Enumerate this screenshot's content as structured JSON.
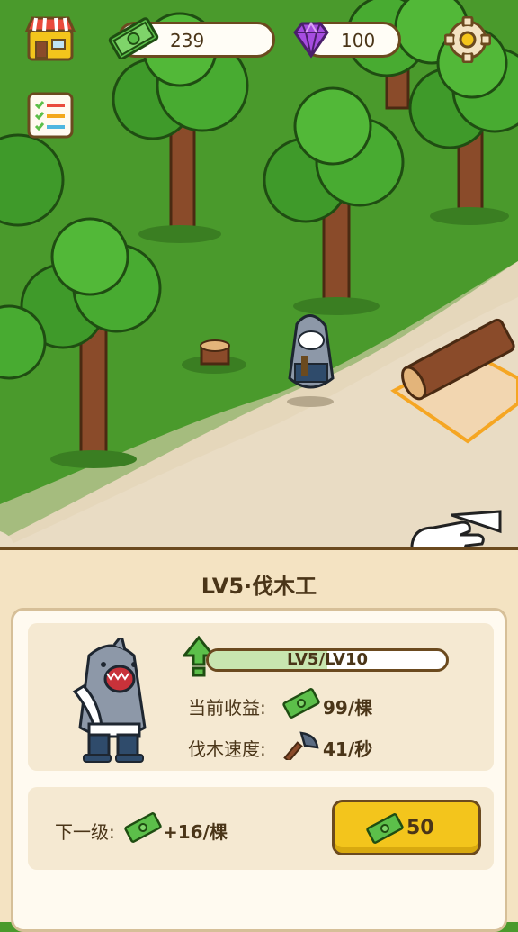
{
  "hud": {
    "cash": "239",
    "gems": "100"
  },
  "panel": {
    "title": "LV5·伐木工",
    "level_progress": "LV5/LV10",
    "level_current": 5,
    "level_max": 10,
    "income_label": "当前收益:",
    "income_value": "99/棵",
    "speed_label": "伐木速度:",
    "speed_value": "41/秒",
    "next_label": "下一级:",
    "next_value": "+16/棵",
    "upgrade_price": "50"
  },
  "colors": {
    "grass": "#4a9a2c",
    "path": "#e9dcc4",
    "panel_bg": "#f4e3c2",
    "button_yellow": "#f3c51c",
    "outline_brown": "#6b4a1f",
    "cash_green": "#5cbf4a",
    "gem_purple": "#a64de0"
  },
  "icons": [
    "shop-icon",
    "task-list-icon",
    "settings-gear-icon",
    "cash-icon",
    "gem-icon",
    "level-up-arrow-icon",
    "axe-icon",
    "tap-hand-icon"
  ]
}
